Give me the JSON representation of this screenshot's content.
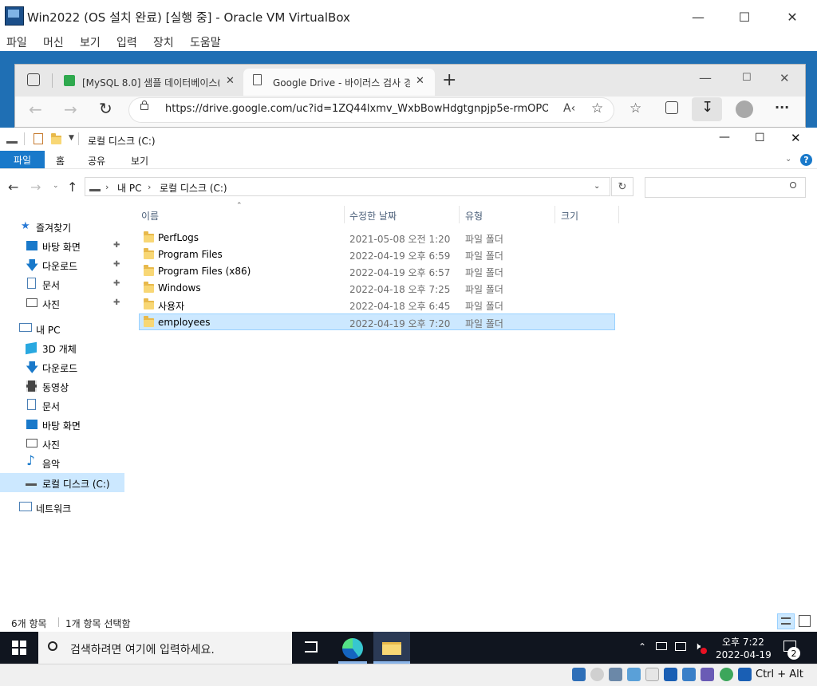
{
  "vbox": {
    "title": "Win2022 (OS 설치 완료) [실행 중] - Oracle VM VirtualBox",
    "menu": [
      "파일",
      "머신",
      "보기",
      "입력",
      "장치",
      "도움말"
    ],
    "status_keys": "Ctrl + Alt"
  },
  "edge": {
    "tabs": [
      {
        "label": "[MySQL 8.0] 샘플 데이터베이스("
      },
      {
        "label": "Google Drive - 바이러스 검사 경"
      }
    ],
    "url": "https://drive.google.com/uc?id=1ZQ44lxmv_WxbBowHdgtgnpjp5e-rmOPO..."
  },
  "explorer": {
    "title": "로컬 디스크 (C:)",
    "ribbon": {
      "file": "파일",
      "home": "홈",
      "share": "공유",
      "view": "보기"
    },
    "breadcrumb": {
      "pc": "내 PC",
      "drive": "로컬 디스크 (C:)"
    },
    "nav": {
      "quick_access": "즐겨찾기",
      "quick_items": [
        "바탕 화면",
        "다운로드",
        "문서",
        "사진"
      ],
      "this_pc": "내 PC",
      "pc_items": [
        "3D 개체",
        "다운로드",
        "동영상",
        "문서",
        "바탕 화면",
        "사진",
        "음악",
        "로컬 디스크 (C:)"
      ],
      "network": "네트워크"
    },
    "columns": {
      "name": "이름",
      "modified": "수정한 날짜",
      "type": "유형",
      "size": "크기"
    },
    "files": [
      {
        "name": "PerfLogs",
        "modified": "2021-05-08 오전 1:20",
        "type": "파일 폴더"
      },
      {
        "name": "Program Files",
        "modified": "2022-04-19 오후 6:59",
        "type": "파일 폴더"
      },
      {
        "name": "Program Files (x86)",
        "modified": "2022-04-19 오후 6:57",
        "type": "파일 폴더"
      },
      {
        "name": "Windows",
        "modified": "2022-04-18 오후 7:25",
        "type": "파일 폴더"
      },
      {
        "name": "사용자",
        "modified": "2022-04-18 오후 6:45",
        "type": "파일 폴더"
      },
      {
        "name": "employees",
        "modified": "2022-04-19 오후 7:20",
        "type": "파일 폴더"
      }
    ],
    "status": {
      "count": "6개 항목",
      "selected": "1개 항목 선택함"
    }
  },
  "taskbar": {
    "search_placeholder": "검색하려면 여기에 입력하세요.",
    "time": "오후 7:22",
    "date": "2022-04-19",
    "notification_count": "2"
  },
  "colors": {
    "ribbon_file": "#1979ca",
    "selection": "#cce8ff",
    "taskbar": "#10151f",
    "folder": "#f8d775"
  }
}
